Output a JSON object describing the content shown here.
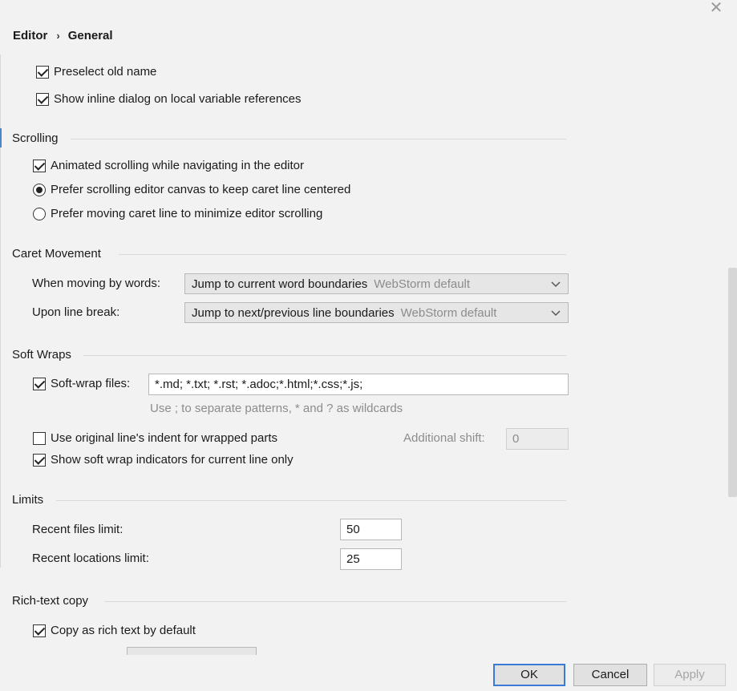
{
  "breadcrumb": {
    "parent": "Editor",
    "separator": "›",
    "current": "General"
  },
  "window": {
    "close_glyph": "✕"
  },
  "rename": {
    "preselect_old_name": {
      "label": "Preselect old name",
      "checked": true
    },
    "inline_dialog": {
      "label": "Show inline dialog on local variable references",
      "checked": true
    }
  },
  "scrolling": {
    "title": "Scrolling",
    "animated": {
      "label": "Animated scrolling while navigating in the editor",
      "checked": true
    },
    "prefer_canvas": {
      "label": "Prefer scrolling editor canvas to keep caret line centered",
      "checked": true
    },
    "prefer_caret": {
      "label": "Prefer moving caret line to minimize editor scrolling",
      "checked": false
    }
  },
  "caret": {
    "title": "Caret Movement",
    "words_label": "When moving by words:",
    "words_value": "Jump to current word boundaries",
    "words_hint": "WebStorm default",
    "linebreak_label": "Upon line break:",
    "linebreak_value": "Jump to next/previous line boundaries",
    "linebreak_hint": "WebStorm default"
  },
  "softwraps": {
    "title": "Soft Wraps",
    "files_label": "Soft-wrap files:",
    "files_checked": true,
    "files_value": "*.md; *.txt; *.rst; *.adoc;*.html;*.css;*.js;",
    "files_help": "Use ; to separate patterns, * and ? as wildcards",
    "indent_label": "Use original line's indent for wrapped parts",
    "indent_checked": false,
    "shift_label": "Additional shift:",
    "shift_value": "0",
    "indicators_label": "Show soft wrap indicators for current line only",
    "indicators_checked": true
  },
  "limits": {
    "title": "Limits",
    "recent_files_label": "Recent files limit:",
    "recent_files_value": "50",
    "recent_locations_label": "Recent locations limit:",
    "recent_locations_value": "25"
  },
  "richtext": {
    "title": "Rich-text copy",
    "copy_label": "Copy as rich text by default",
    "copy_checked": true
  },
  "footer": {
    "ok": "OK",
    "cancel": "Cancel",
    "apply": "Apply"
  },
  "colors": {
    "accent": "#3a7bd5",
    "background": "#f2f2f2"
  }
}
